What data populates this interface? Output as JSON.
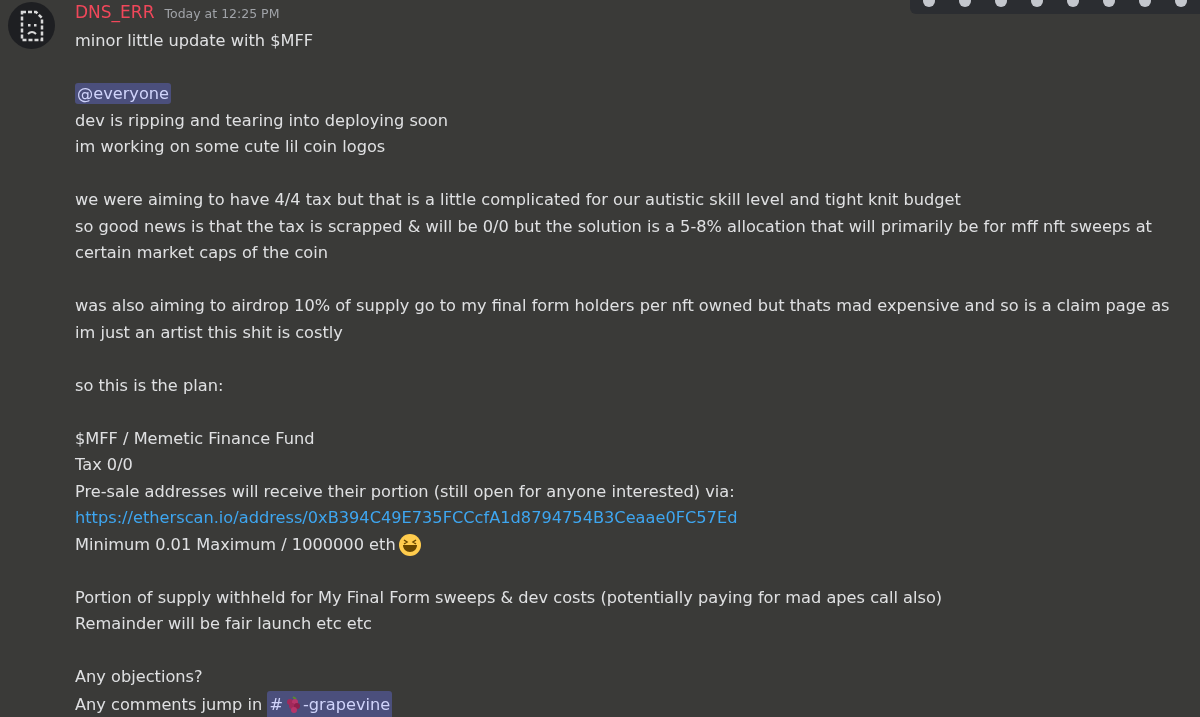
{
  "message": {
    "author": "DNS_ERR",
    "timestamp": "Today at 12:25 PM",
    "paragraphs": [
      [
        [
          {
            "kind": "text",
            "text": "minor little update with $MFF"
          }
        ]
      ],
      [
        [
          {
            "kind": "mention",
            "text": "@everyone"
          }
        ],
        [
          {
            "kind": "text",
            "text": "dev is ripping and tearing into deploying soon"
          }
        ],
        [
          {
            "kind": "text",
            "text": "im working on some cute lil coin logos"
          }
        ]
      ],
      [
        [
          {
            "kind": "text",
            "text": "we were aiming to have 4/4 tax but that is a little complicated for our autistic skill level and tight knit budget"
          }
        ],
        [
          {
            "kind": "text",
            "text": "so good news is that the tax is scrapped & will be 0/0 but the solution is a 5-8% allocation that will primarily be for mff nft sweeps at certain market caps of the coin"
          }
        ]
      ],
      [
        [
          {
            "kind": "text",
            "text": "was also aiming to airdrop 10% of supply go to my final form holders per nft owned but thats mad expensive and so is a claim page as im just an artist this shit is costly"
          }
        ]
      ],
      [
        [
          {
            "kind": "text",
            "text": "so this is the plan:"
          }
        ]
      ],
      [
        [
          {
            "kind": "text",
            "text": "$MFF / Memetic Finance Fund"
          }
        ],
        [
          {
            "kind": "text",
            "text": "Tax 0/0"
          }
        ],
        [
          {
            "kind": "text",
            "text": "Pre-sale addresses will receive their portion (still open for anyone interested) via:"
          }
        ],
        [
          {
            "kind": "link",
            "text": "https://etherscan.io/address/0xB394C49E735FCCcfA1d8794754B3Ceaae0FC57Ed"
          }
        ],
        [
          {
            "kind": "text",
            "text": "Minimum 0.01 Maximum / 1000000 eth"
          },
          {
            "kind": "emoji"
          }
        ]
      ],
      [
        [
          {
            "kind": "text",
            "text": "Portion of supply withheld for My Final Form sweeps & dev costs (potentially paying for mad apes call also)"
          }
        ],
        [
          {
            "kind": "text",
            "text": "Remainder will be fair launch etc etc"
          }
        ]
      ],
      [
        [
          {
            "kind": "text",
            "text": "Any objections?"
          }
        ],
        [
          {
            "kind": "text",
            "text": "Any comments jump in "
          },
          {
            "kind": "channel",
            "text": "#",
            "name": "-grapevine"
          }
        ]
      ]
    ]
  }
}
